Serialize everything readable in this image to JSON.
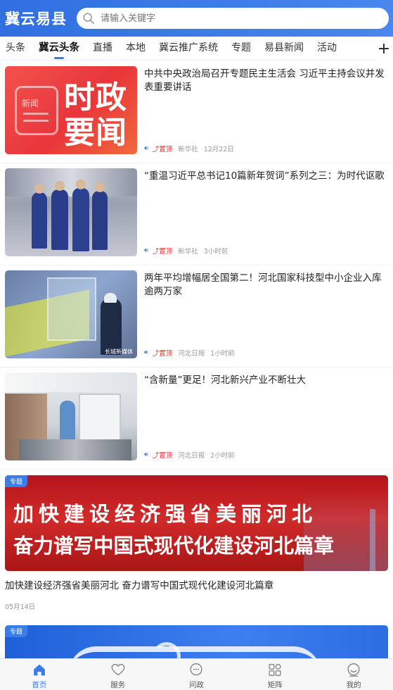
{
  "header": {
    "brand": "冀云易县",
    "search_placeholder": "请输入关键字"
  },
  "tabs": [
    {
      "label": "头条"
    },
    {
      "label": "冀云头条",
      "active": true
    },
    {
      "label": "直播"
    },
    {
      "label": "本地"
    },
    {
      "label": "冀云推广系统"
    },
    {
      "label": "专题"
    },
    {
      "label": "易县新闻"
    },
    {
      "label": "活动"
    }
  ],
  "tabs_more_icon": "plus-icon",
  "news": [
    {
      "title": "中共中央政治局召开专题民主生活会 习近平主持会议并发表重要讲话",
      "top_label": "置顶",
      "source": "新华社",
      "time": "12月22日",
      "thumb_text": {
        "small": "新闻",
        "big1": "时政",
        "big2": "要闻"
      }
    },
    {
      "title": "“重温习近平总书记10篇新年贺词”系列之三：为时代讴歌",
      "top_label": "置顶",
      "source": "新华社",
      "time": "3小时前"
    },
    {
      "title": "两年平均增幅居全国第二！河北国家科技型中小企业入库逾两万家",
      "top_label": "置顶",
      "source": "河北日报",
      "time": "1小时前",
      "thumb_text": {
        "watermark": "长城新媒体"
      }
    },
    {
      "title": "“含新量”更足！河北新兴产业不断壮大",
      "top_label": "置顶",
      "source": "河北日报",
      "time": "2小时前"
    }
  ],
  "special": {
    "tag": "专题",
    "banner_line1": "加快建设经济强省美丽河北",
    "banner_line2": "奋力谱写中国式现代化建设河北篇章",
    "title": "加快建设经济强省美丽河北 奋力谱写中国式现代化建设河北篇章",
    "date": "05月14日"
  },
  "special2": {
    "tag": "专题"
  },
  "bottom_nav": [
    {
      "label": "首页",
      "icon": "home-icon",
      "active": true
    },
    {
      "label": "服务",
      "icon": "heart-icon"
    },
    {
      "label": "问政",
      "icon": "chat-icon"
    },
    {
      "label": "矩阵",
      "icon": "grid-icon"
    },
    {
      "label": "我的",
      "icon": "user-icon"
    }
  ],
  "colors": {
    "accent": "#3b7de8",
    "top_label": "#e02d2d",
    "header_start": "#2f6fe0",
    "header_end": "#4a86ee"
  }
}
